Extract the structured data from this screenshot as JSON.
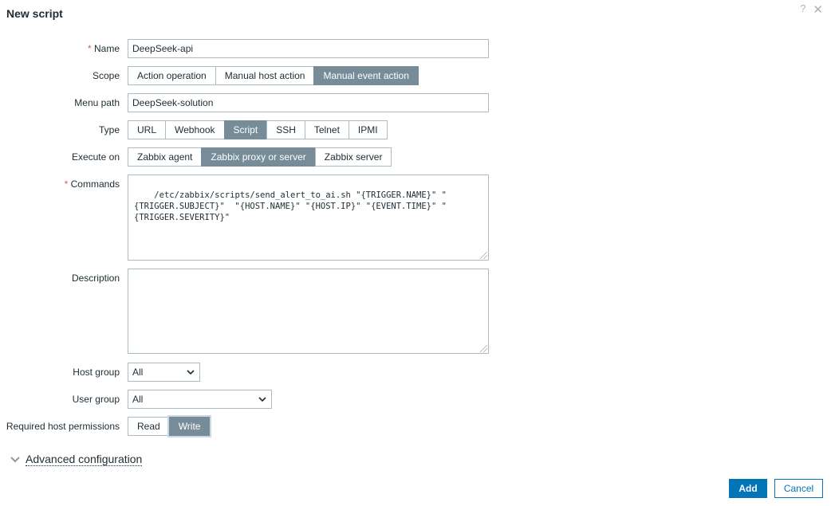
{
  "dialog": {
    "title": "New script",
    "help_icon": "?",
    "close_icon": "✕"
  },
  "form": {
    "name": {
      "label": "Name",
      "value": "DeepSeek-api"
    },
    "scope": {
      "label": "Scope",
      "options": [
        "Action operation",
        "Manual host action",
        "Manual event action"
      ],
      "selected": "Manual event action"
    },
    "menu_path": {
      "label": "Menu path",
      "value": "DeepSeek-solution"
    },
    "type": {
      "label": "Type",
      "options": [
        "URL",
        "Webhook",
        "Script",
        "SSH",
        "Telnet",
        "IPMI"
      ],
      "selected": "Script"
    },
    "execute_on": {
      "label": "Execute on",
      "options": [
        "Zabbix agent",
        "Zabbix proxy or server",
        "Zabbix server"
      ],
      "selected": "Zabbix proxy or server"
    },
    "commands": {
      "label": "Commands",
      "value": "/etc/zabbix/scripts/send_alert_to_ai.sh \"{TRIGGER.NAME}\" \"{TRIGGER.SUBJECT}\"  \"{HOST.NAME}\" \"{HOST.IP}\" \"{EVENT.TIME}\" \"{TRIGGER.SEVERITY}\""
    },
    "description": {
      "label": "Description",
      "value": ""
    },
    "host_group": {
      "label": "Host group",
      "value": "All"
    },
    "user_group": {
      "label": "User group",
      "value": "All"
    },
    "required_host_permissions": {
      "label": "Required host permissions",
      "options": [
        "Read",
        "Write"
      ],
      "selected": "Write"
    },
    "advanced": {
      "label": "Advanced configuration"
    }
  },
  "buttons": {
    "add": "Add",
    "cancel": "Cancel"
  },
  "colors": {
    "accent": "#0275b8",
    "selected_segment": "#768d99",
    "required_star": "#e45959",
    "border": "#acbbc2"
  }
}
